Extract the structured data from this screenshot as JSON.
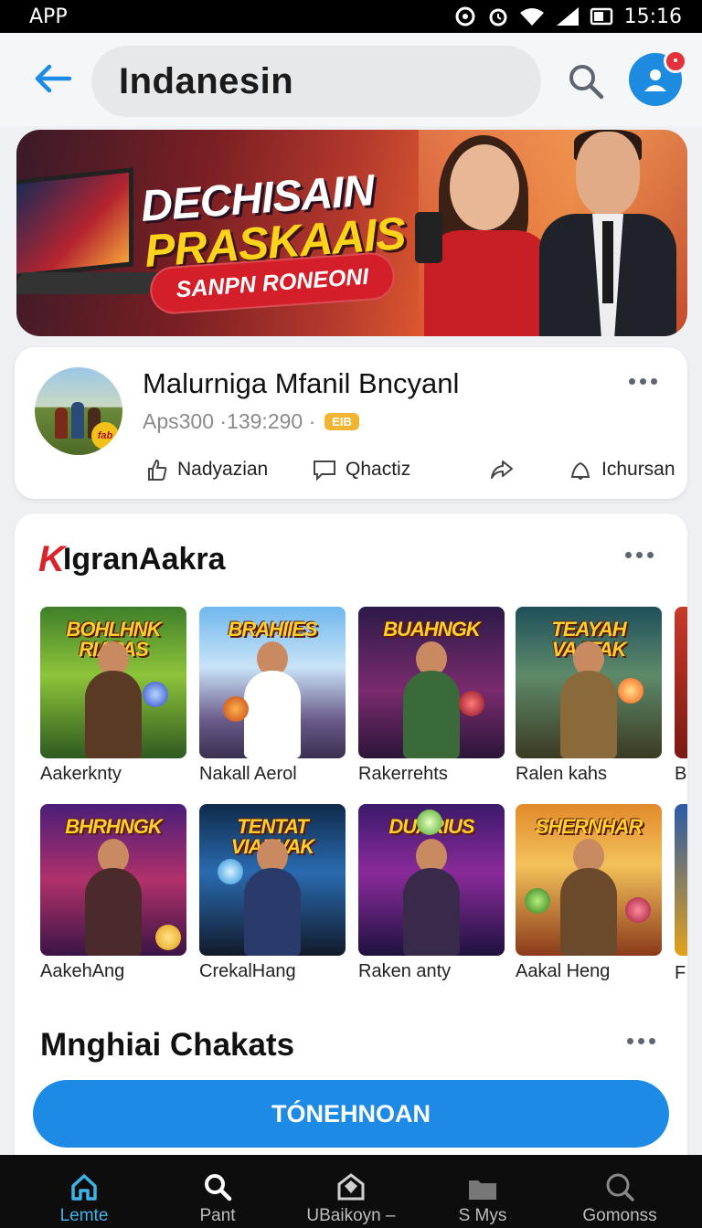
{
  "status_bar": {
    "app_label": "APP",
    "time": "15:16"
  },
  "header": {
    "title": "Indanesin"
  },
  "banner": {
    "line1": "DECHISAIN",
    "line2": "PRASKAAIS",
    "pill": "SANPN RONEONI"
  },
  "post": {
    "title": "Malurniga Mfanil Bncyanl",
    "meta": "Aps300 ·139:290 ·",
    "badge": "EIB",
    "avatar_tag": "fab",
    "actions": [
      {
        "label": "Nadyazian",
        "icon": "like-icon"
      },
      {
        "label": "Qhactiz",
        "icon": "comment-icon"
      },
      {
        "label": "",
        "icon": "share-icon"
      },
      {
        "label": "Ichursan",
        "icon": "bell-icon"
      }
    ]
  },
  "section": {
    "logo_mark": "K",
    "title": "IgranAakra",
    "row1": [
      {
        "game_title": "BOHLHNK RIAPAS",
        "label": "Aakerknty"
      },
      {
        "game_title": "BRAHIIES",
        "label": "Nakall Aerol"
      },
      {
        "game_title": "BUAHNGK",
        "label": "Rakerrehts"
      },
      {
        "game_title": "TEAYAH VAATAK",
        "label": "Ralen kahs"
      }
    ],
    "row1_peek": "B",
    "row2": [
      {
        "game_title": "BHRHNGK",
        "label": "AakehAng"
      },
      {
        "game_title": "TENTAT VIAHVAK",
        "label": "CrekalHang"
      },
      {
        "game_title": "DUARIUS",
        "label": "Raken anty"
      },
      {
        "game_title": "SHERNHAR",
        "label": "Aakal Heng"
      }
    ],
    "row2_peek": "F",
    "second_title": "Mnghiai Chakats",
    "cta": "TÓNEHNOAN"
  },
  "bottom_nav": [
    {
      "label": "Lemte",
      "icon": "home-icon",
      "active": true
    },
    {
      "label": "Pant",
      "icon": "search-icon",
      "active": false
    },
    {
      "label": "UBaikoyn –",
      "icon": "store-icon",
      "active": false
    },
    {
      "label": "S Mys",
      "icon": "folder-icon",
      "active": false
    },
    {
      "label": "Gomonss",
      "icon": "search-icon",
      "active": false
    }
  ],
  "colors": {
    "accent": "#1d8be6",
    "active_nav": "#3fb3e8",
    "badge": "#f1b531",
    "notification": "#e2323a"
  }
}
